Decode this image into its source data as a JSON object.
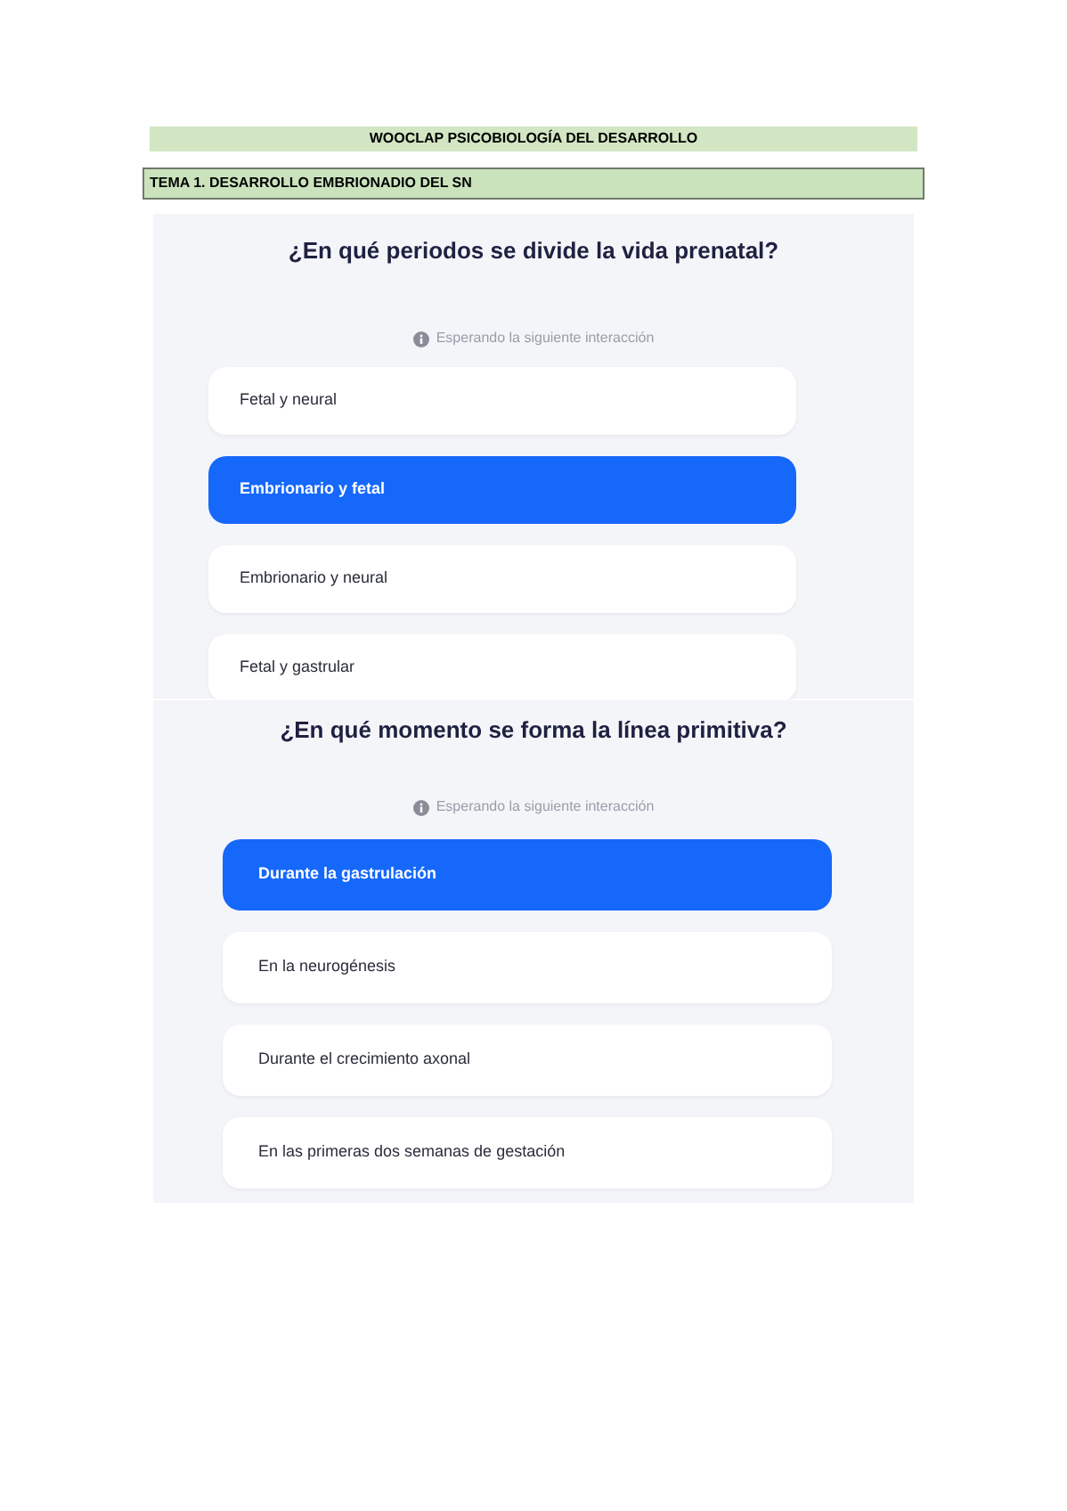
{
  "document_title": "WOOCLAP PSICOBIOLOGÍA DEL DESARROLLO",
  "section_title": "TEMA 1. DESARROLLO EMBRIONADIO DEL SN",
  "questions": [
    {
      "question": "¿En qué periodos se divide la vida prenatal?",
      "status": "Esperando la siguiente interacción",
      "options": [
        {
          "label": "Fetal y neural",
          "selected": false
        },
        {
          "label": "Embrionario y fetal",
          "selected": true
        },
        {
          "label": "Embrionario y neural",
          "selected": false
        },
        {
          "label": "Fetal y gastrular",
          "selected": false
        }
      ]
    },
    {
      "question": "¿En qué momento se forma la línea primitiva?",
      "status": "Esperando la siguiente interacción",
      "options": [
        {
          "label": "Durante la gastrulación",
          "selected": true
        },
        {
          "label": "En la neurogénesis",
          "selected": false
        },
        {
          "label": "Durante el crecimiento axonal",
          "selected": false
        },
        {
          "label": "En las primeras dos semanas de gestación",
          "selected": false
        }
      ]
    }
  ]
}
